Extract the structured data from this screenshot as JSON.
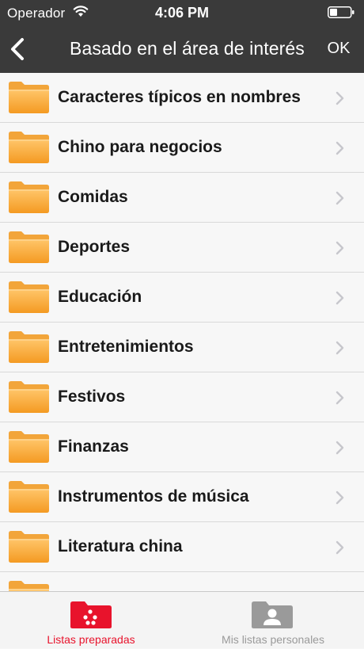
{
  "status_bar": {
    "carrier": "Operador",
    "time": "4:06 PM"
  },
  "nav": {
    "title": "Basado en el área de interés",
    "ok_label": "OK",
    "back_icon": "chevron-left-icon"
  },
  "list": {
    "items": [
      {
        "label": "Caracteres típicos en nombres"
      },
      {
        "label": "Chino para negocios"
      },
      {
        "label": "Comidas"
      },
      {
        "label": "Deportes"
      },
      {
        "label": "Educación"
      },
      {
        "label": "Entretenimientos"
      },
      {
        "label": "Festivos"
      },
      {
        "label": "Finanzas"
      },
      {
        "label": "Instrumentos de música"
      },
      {
        "label": "Literatura china"
      },
      {
        "label": ""
      }
    ],
    "item_icon": "folder-icon",
    "chevron_icon": "chevron-right-icon"
  },
  "tab_bar": {
    "tabs": [
      {
        "label": "Listas preparadas",
        "icon": "folder-dots-icon",
        "selected": true
      },
      {
        "label": "Mis listas personales",
        "icon": "folder-person-icon",
        "selected": false
      }
    ]
  },
  "colors": {
    "header_bg": "#3a3a3a",
    "accent": "#e8132c",
    "folder_orange": "#f7a435",
    "inactive_tab": "#9a9a9a"
  }
}
